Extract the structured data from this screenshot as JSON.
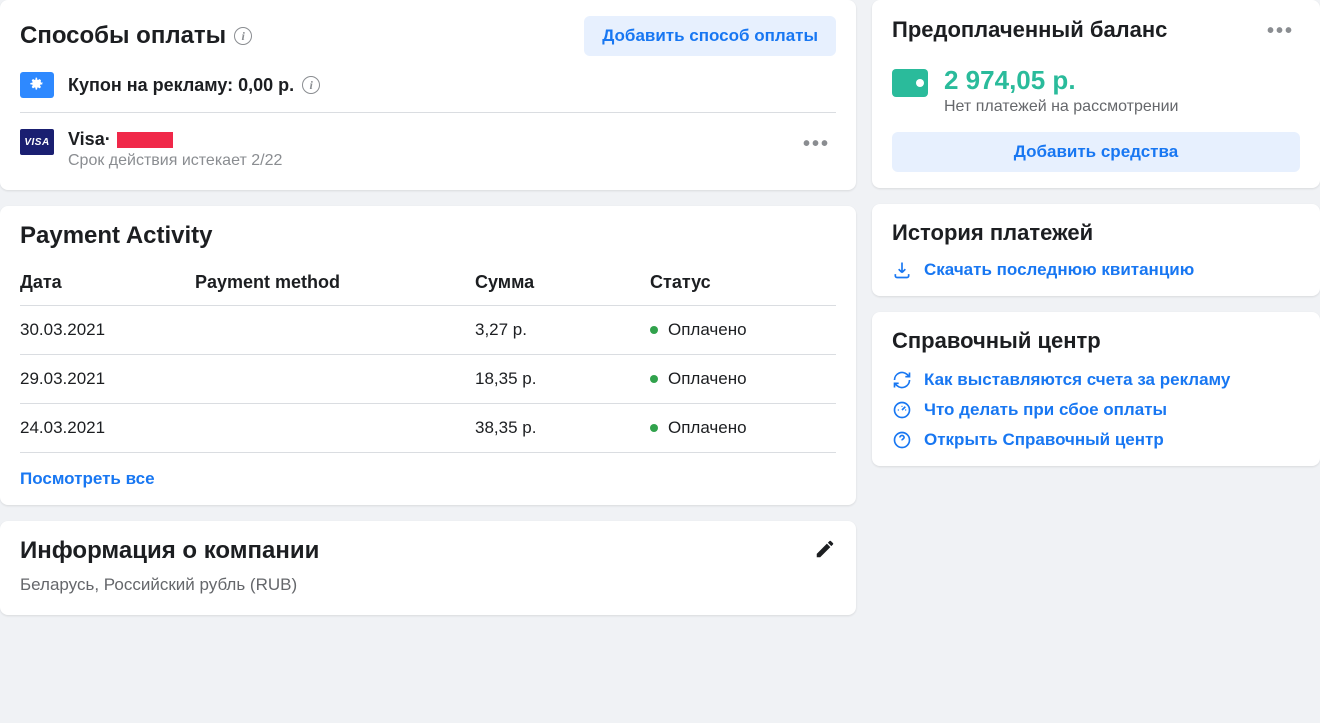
{
  "paymentMethods": {
    "title": "Способы оплаты",
    "addButton": "Добавить способ оплаты",
    "coupon": {
      "label": "Купон на рекламу: 0,00 р."
    },
    "card": {
      "brand": "VISA",
      "name": "Visa",
      "separator": " · ",
      "expiresLabel": "Срок действия истекает 2/22"
    }
  },
  "activity": {
    "title": "Payment Activity",
    "headers": {
      "date": "Дата",
      "method": "Payment method",
      "amount": "Сумма",
      "status": "Статус"
    },
    "rows": [
      {
        "date": "30.03.2021",
        "method": "",
        "amount": "3,27 р.",
        "status": "Оплачено"
      },
      {
        "date": "29.03.2021",
        "method": "",
        "amount": "18,35 р.",
        "status": "Оплачено"
      },
      {
        "date": "24.03.2021",
        "method": "",
        "amount": "38,35 р.",
        "status": "Оплачено"
      }
    ],
    "viewAll": "Посмотреть все"
  },
  "company": {
    "title": "Информация о компании",
    "detail": "Беларусь, Российский рубль (RUB)"
  },
  "balance": {
    "title": "Предоплаченный баланс",
    "amount": "2 974,05 р.",
    "pending": "Нет платежей на рассмотрении",
    "addFunds": "Добавить средства"
  },
  "history": {
    "title": "История платежей",
    "downloadReceipt": "Скачать последнюю квитанцию"
  },
  "help": {
    "title": "Справочный центр",
    "links": [
      "Как выставляются счета за рекламу",
      "Что делать при сбое оплаты",
      "Открыть Справочный центр"
    ]
  }
}
